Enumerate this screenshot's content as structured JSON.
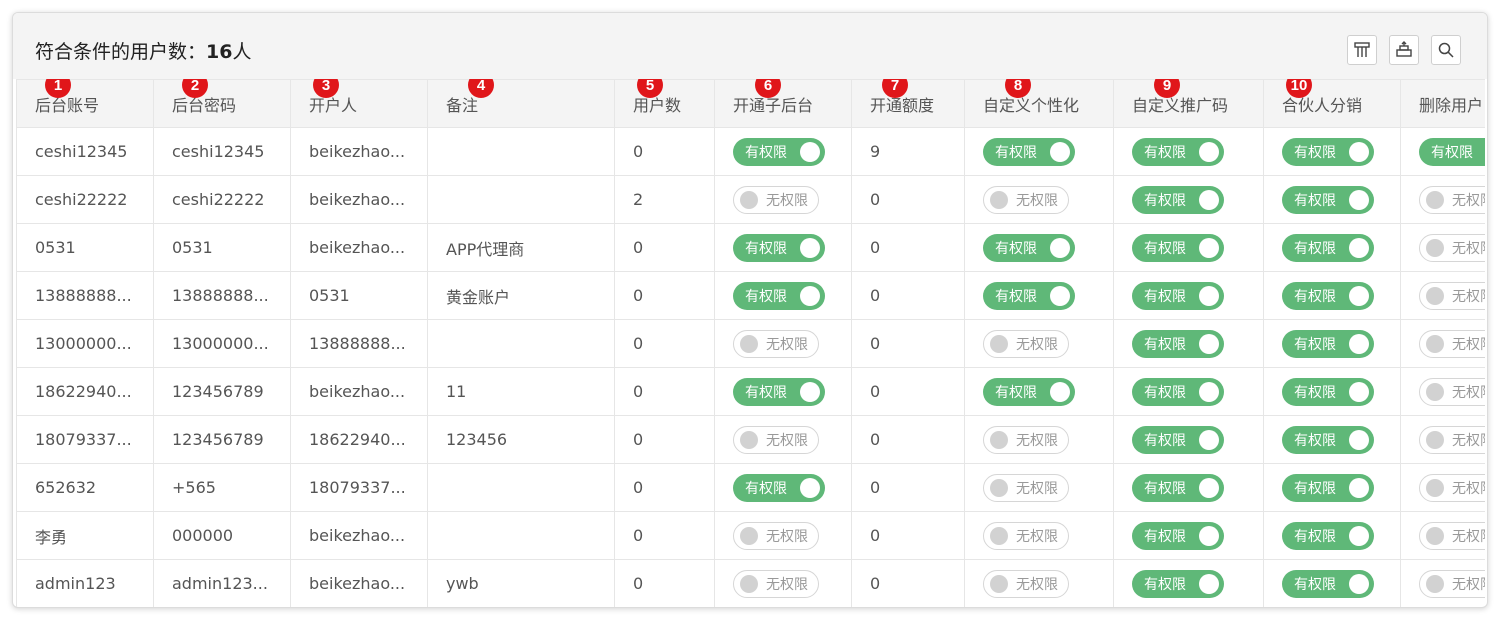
{
  "summary": {
    "label": "符合条件的用户数：",
    "count": "16",
    "unit": "人"
  },
  "toolbar": [
    {
      "icon": "columns-icon"
    },
    {
      "icon": "print-icon"
    },
    {
      "icon": "search-icon"
    }
  ],
  "markers": [
    "1",
    "2",
    "3",
    "4",
    "5",
    "6",
    "7",
    "8",
    "9",
    "10"
  ],
  "columns": [
    "后台账号",
    "后台密码",
    "开户人",
    "备注",
    "用户数",
    "开通子后台",
    "开通额度",
    "自定义个性化",
    "自定义推广码",
    "合伙人分销",
    "删除用户"
  ],
  "toggle_labels": {
    "on": "有权限",
    "off": "无权限"
  },
  "rows": [
    {
      "account": "ceshi12345",
      "password": "ceshi12345",
      "opener": "beikezhao...",
      "note": "",
      "users": "0",
      "sub_admin": "有权限",
      "quota": "9",
      "custom": "有权限",
      "promo": "有权限",
      "partner": "有权限",
      "delete": "有权限"
    },
    {
      "account": "ceshi22222",
      "password": "ceshi22222",
      "opener": "beikezhao...",
      "note": "",
      "users": "2",
      "sub_admin": "无权限",
      "quota": "0",
      "custom": "无权限",
      "promo": "有权限",
      "partner": "有权限",
      "delete": "无权限"
    },
    {
      "account": "0531",
      "password": "0531",
      "opener": "beikezhao...",
      "note": "APP代理商",
      "users": "0",
      "sub_admin": "有权限",
      "quota": "0",
      "custom": "有权限",
      "promo": "有权限",
      "partner": "有权限",
      "delete": "无权限"
    },
    {
      "account": "13888888...",
      "password": "13888888...",
      "opener": "0531",
      "note": "黄金账户",
      "users": "0",
      "sub_admin": "有权限",
      "quota": "0",
      "custom": "有权限",
      "promo": "有权限",
      "partner": "有权限",
      "delete": "无权限"
    },
    {
      "account": "13000000...",
      "password": "13000000...",
      "opener": "13888888...",
      "note": "",
      "users": "0",
      "sub_admin": "无权限",
      "quota": "0",
      "custom": "无权限",
      "promo": "有权限",
      "partner": "有权限",
      "delete": "无权限"
    },
    {
      "account": "18622940...",
      "password": "123456789",
      "opener": "beikezhao...",
      "note": "11",
      "users": "0",
      "sub_admin": "有权限",
      "quota": "0",
      "custom": "有权限",
      "promo": "有权限",
      "partner": "有权限",
      "delete": "无权限"
    },
    {
      "account": "18079337...",
      "password": "123456789",
      "opener": "18622940...",
      "note": "123456",
      "users": "0",
      "sub_admin": "无权限",
      "quota": "0",
      "custom": "无权限",
      "promo": "有权限",
      "partner": "有权限",
      "delete": "无权限"
    },
    {
      "account": "652632",
      "password": "+565",
      "opener": "18079337...",
      "note": "",
      "users": "0",
      "sub_admin": "有权限",
      "quota": "0",
      "custom": "无权限",
      "promo": "有权限",
      "partner": "有权限",
      "delete": "无权限"
    },
    {
      "account": "李勇",
      "password": "000000",
      "opener": "beikezhao...",
      "note": "",
      "users": "0",
      "sub_admin": "无权限",
      "quota": "0",
      "custom": "无权限",
      "promo": "有权限",
      "partner": "有权限",
      "delete": "无权限"
    },
    {
      "account": "admin123",
      "password": "admin123...",
      "opener": "beikezhao...",
      "note": "ywb",
      "users": "0",
      "sub_admin": "无权限",
      "quota": "0",
      "custom": "无权限",
      "promo": "有权限",
      "partner": "有权限",
      "delete": "无权限"
    }
  ],
  "colors": {
    "toggle_on": "#5fb878",
    "marker": "#e0161a",
    "header_bg": "#f4f4f4"
  }
}
